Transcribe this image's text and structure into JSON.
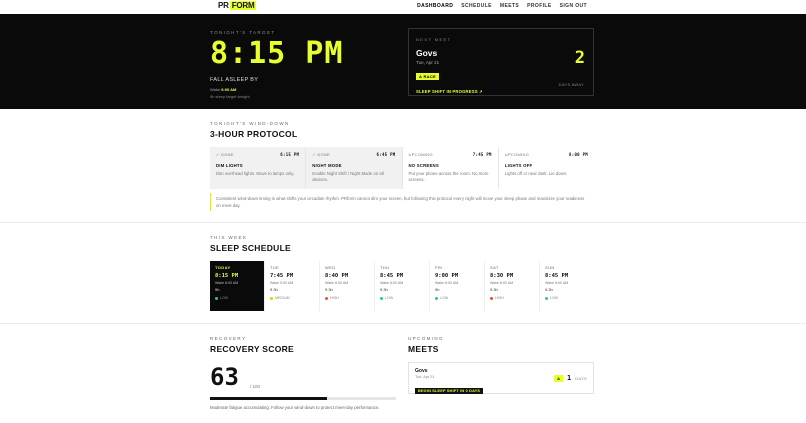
{
  "nav": {
    "logo_pr": "PR",
    "logo_form": "FORM",
    "links": [
      "DASHBOARD",
      "SCHEDULE",
      "MEETS",
      "PROFILE",
      "SIGN OUT"
    ]
  },
  "hero": {
    "kicker": "TONIGHT'S TARGET",
    "time": "8:15 PM",
    "fall_asleep_label": "FALL ASLEEP BY",
    "wake_prefix": "Wake ",
    "wake_time": "6:00 AM",
    "sleep_target": "9h sleep target tonight"
  },
  "next_meet": {
    "kicker": "NEXT MEET",
    "name": "Govs",
    "date": "Tue, Apr 21",
    "tag": "A RACE",
    "shift": "SLEEP SHIFT IN PROGRESS ↗",
    "days": "2",
    "days_label": "DAYS AWAY"
  },
  "wind_down": {
    "kicker": "TONIGHT'S WIND-DOWN",
    "title": "3-HOUR PROTOCOL",
    "steps": [
      {
        "status": "✓ DONE",
        "time": "6:15 PM",
        "name": "DIM LIGHTS",
        "desc": "Dim overhead lights. Move to lamps only."
      },
      {
        "status": "✓ DONE",
        "time": "6:45 PM",
        "name": "NIGHT MODE",
        "desc": "Enable Night Shift / Night Mode on all devices."
      },
      {
        "status": "UPCOMING",
        "time": "7:45 PM",
        "name": "NO SCREENS",
        "desc": "Put your phone across the room. No more screens."
      },
      {
        "status": "UPCOMING",
        "time": "8:00 PM",
        "name": "LIGHTS OFF",
        "desc": "Lights off or near dark. Lie down."
      }
    ],
    "note": "Consistent wind-down timing is what shifts your circadian rhythm. PRform cannot dim your screen, but following this protocol every night will move your sleep phase and maximize your readiness on meet day."
  },
  "schedule": {
    "kicker": "THIS WEEK",
    "title": "SLEEP SCHEDULE",
    "days": [
      {
        "name": "TODAY",
        "time": "8:15 PM",
        "wake": "Wake 6:00 AM",
        "hours": "9h",
        "load": "LOW",
        "load_color": "#2ecc71",
        "today": true
      },
      {
        "name": "TUE",
        "time": "7:45 PM",
        "wake": "Wake 5:00 AM",
        "hours": "9.3h",
        "load": "MEDIUM",
        "load_color": "#f1c40f",
        "today": false
      },
      {
        "name": "WED",
        "time": "8:40 PM",
        "wake": "Wake 6:00 AM",
        "hours": "9.3h",
        "load": "HIGH",
        "load_color": "#e74c3c",
        "today": false
      },
      {
        "name": "THU",
        "time": "8:45 PM",
        "wake": "Wake 6:00 AM",
        "hours": "9.3h",
        "load": "LOW",
        "load_color": "#2ecc71",
        "today": false
      },
      {
        "name": "FRI",
        "time": "9:00 PM",
        "wake": "Wake 6:00 AM",
        "hours": "9h",
        "load": "LOW",
        "load_color": "#2ecc71",
        "today": false
      },
      {
        "name": "SAT",
        "time": "8:30 PM",
        "wake": "Wake 6:00 AM",
        "hours": "9.3h",
        "load": "HIGH",
        "load_color": "#e74c3c",
        "today": false
      },
      {
        "name": "SUN",
        "time": "8:45 PM",
        "wake": "Wake 6:00 AM",
        "hours": "9.3h",
        "load": "LOW",
        "load_color": "#2ecc71",
        "today": false
      }
    ]
  },
  "recovery": {
    "kicker": "RECOVERY",
    "title": "RECOVERY SCORE",
    "score": "63",
    "out_of": "/ 100",
    "fraction": 0.63,
    "note": "Moderate fatigue accumulating. Follow your wind-down to protect meet-day performance."
  },
  "upcoming": {
    "kicker": "UPCOMING",
    "title": "MEETS",
    "meets": [
      {
        "name": "Govs",
        "date": "Tue, Apr 21",
        "tag": "BEGIN SLEEP SHIFT IN 0 DAYS",
        "priority": "A",
        "days": "1",
        "days_label": "DAYS"
      }
    ]
  }
}
